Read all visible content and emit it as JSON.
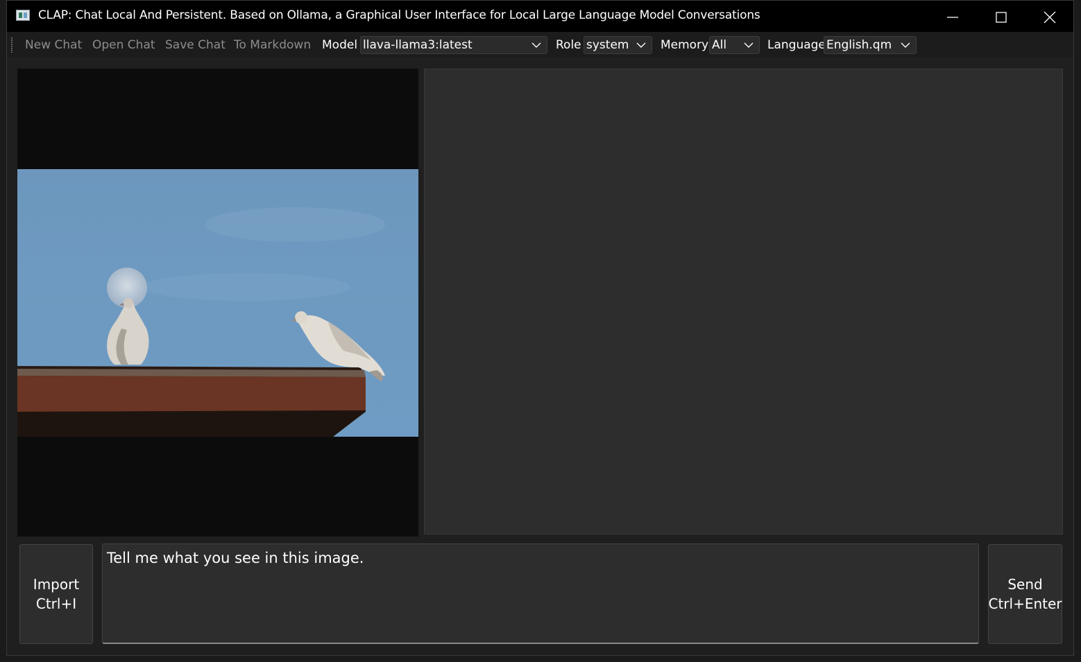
{
  "window": {
    "title": "CLAP: Chat Local And Persistent. Based on Ollama, a Graphical User Interface for Local Large Language Model Conversations"
  },
  "toolbar": {
    "actions": [
      "New Chat",
      "Open Chat",
      "Save Chat",
      "To Markdown"
    ],
    "model_label": "Model",
    "model_value": "llava-llama3:latest",
    "role_label": "Role",
    "role_value": "system",
    "memory_label": "Memory",
    "memory_value": "All",
    "language_label": "Language",
    "language_value": "English.qm"
  },
  "image_panel": {
    "description_icon": "photo-two-doves-on-roof-with-moon"
  },
  "input": {
    "prompt_text": "Tell me what you see in this image."
  },
  "buttons": {
    "import_label": "Import",
    "import_shortcut": "Ctrl+I",
    "send_label": "Send",
    "send_shortcut": "Ctrl+Enter"
  },
  "colors": {
    "titlebar": "#000000",
    "toolbar": "#1c1c1c",
    "panel": "#2d2d2d",
    "action_text_disabled": "#8d8d8d"
  }
}
